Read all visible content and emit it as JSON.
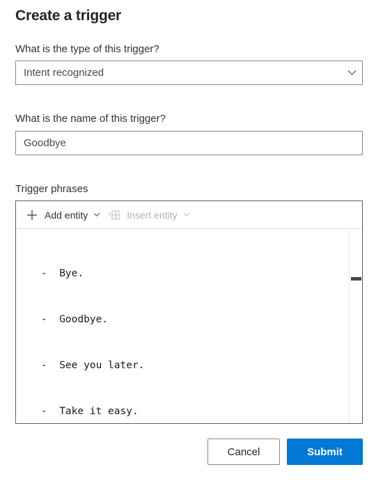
{
  "dialog": {
    "title": "Create a trigger"
  },
  "fields": {
    "type": {
      "label": "What is the type of this trigger?",
      "value": "Intent recognized",
      "chevron_icon": "chevron-down-icon"
    },
    "name": {
      "label": "What is the name of this trigger?",
      "value": "Goodbye",
      "placeholder": ""
    },
    "phrases": {
      "label": "Trigger phrases"
    }
  },
  "toolbar": {
    "add_entity": {
      "label": "Add entity",
      "icon": "plus-icon",
      "caret": "chevron-down-icon",
      "disabled": false
    },
    "insert_entity": {
      "label": "Insert entity",
      "icon": "insert-entity-icon",
      "caret": "chevron-down-icon",
      "disabled": true
    }
  },
  "editor": {
    "lines": [
      "-  Bye.",
      "-  Goodbye.",
      "-  See you later.",
      "-  Take it easy."
    ],
    "scrollbar": {
      "name": "vertical-scrollbar"
    }
  },
  "footer": {
    "cancel_label": "Cancel",
    "submit_label": "Submit"
  },
  "colors": {
    "accent": "#0078d4",
    "border": "#8a8886",
    "editor_border": "#605e5c",
    "text": "#252423",
    "disabled_text": "#b3b0ad"
  }
}
